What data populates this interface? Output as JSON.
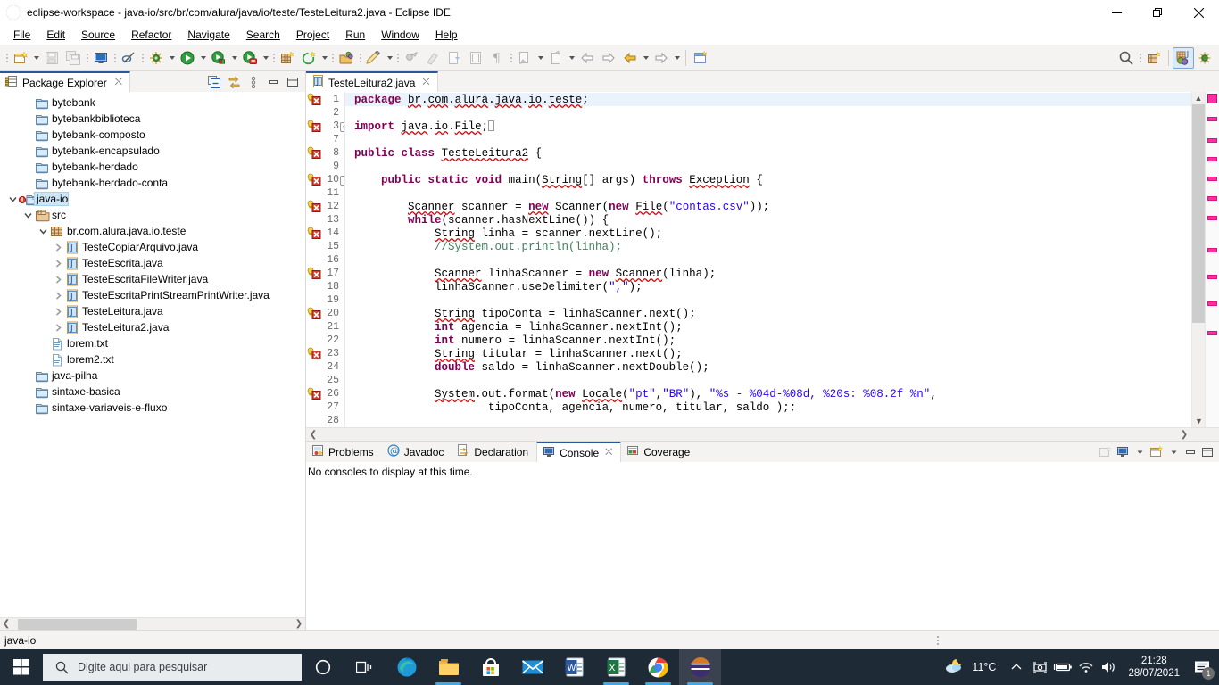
{
  "window": {
    "title": "eclipse-workspace - java-io/src/br/com/alura/java/io/teste/TesteLeitura2.java - Eclipse IDE",
    "minimize": "—",
    "maximize": "❐",
    "close": "✕"
  },
  "menu": [
    {
      "label": "File"
    },
    {
      "label": "Edit"
    },
    {
      "label": "Source"
    },
    {
      "label": "Refactor"
    },
    {
      "label": "Navigate"
    },
    {
      "label": "Search"
    },
    {
      "label": "Project"
    },
    {
      "label": "Run"
    },
    {
      "label": "Window"
    },
    {
      "label": "Help"
    }
  ],
  "toolbar": {
    "items": [
      "new-wizard-icon",
      "save-icon",
      "save-all-icon",
      "print-icon",
      "toggle-mark-occurrences-icon",
      "debug-icon",
      "run-icon",
      "run-external-tools-icon",
      "coverage-icon",
      "new-java-project-icon",
      "open-task-icon",
      "open-type-icon",
      "search-icon",
      "new-window-icon",
      "java-perspective-icon",
      "debug-perspective-icon"
    ]
  },
  "package_explorer": {
    "tab_label": "Package Explorer",
    "tools": [
      "collapse-all-icon",
      "link-with-editor-icon",
      "view-menu-icon",
      "minimize-icon",
      "maximize-icon"
    ],
    "tree": [
      {
        "label": "bytebank",
        "icon": "project-closed-icon",
        "depth": 1,
        "twisty": "",
        "selected": false
      },
      {
        "label": "bytebankbiblioteca",
        "icon": "project-closed-icon",
        "depth": 1,
        "twisty": "",
        "selected": false
      },
      {
        "label": "bytebank-composto",
        "icon": "project-closed-icon",
        "depth": 1,
        "twisty": "",
        "selected": false
      },
      {
        "label": "bytebank-encapsulado",
        "icon": "project-closed-icon",
        "depth": 1,
        "twisty": "",
        "selected": false
      },
      {
        "label": "bytebank-herdado",
        "icon": "project-closed-icon",
        "depth": 1,
        "twisty": "",
        "selected": false
      },
      {
        "label": "bytebank-herdado-conta",
        "icon": "project-closed-icon",
        "depth": 1,
        "twisty": "",
        "selected": false
      },
      {
        "label": "java-io",
        "icon": "java-project-error-icon",
        "depth": 0,
        "twisty": "expanded",
        "selected": true
      },
      {
        "label": "src",
        "icon": "source-folder-icon",
        "depth": 1,
        "twisty": "expanded",
        "selected": false
      },
      {
        "label": "br.com.alura.java.io.teste",
        "icon": "package-icon",
        "depth": 2,
        "twisty": "expanded",
        "selected": false
      },
      {
        "label": "TesteCopiarArquivo.java",
        "icon": "java-file-icon",
        "depth": 3,
        "twisty": "collapsed",
        "selected": false
      },
      {
        "label": "TesteEscrita.java",
        "icon": "java-file-icon",
        "depth": 3,
        "twisty": "collapsed",
        "selected": false
      },
      {
        "label": "TesteEscritaFileWriter.java",
        "icon": "java-file-icon",
        "depth": 3,
        "twisty": "collapsed",
        "selected": false
      },
      {
        "label": "TesteEscritaPrintStreamPrintWriter.java",
        "icon": "java-file-icon",
        "depth": 3,
        "twisty": "collapsed",
        "selected": false
      },
      {
        "label": "TesteLeitura.java",
        "icon": "java-file-icon",
        "depth": 3,
        "twisty": "collapsed",
        "selected": false
      },
      {
        "label": "TesteLeitura2.java",
        "icon": "java-file-icon",
        "depth": 3,
        "twisty": "collapsed",
        "selected": false
      },
      {
        "label": "lorem.txt",
        "icon": "text-file-icon",
        "depth": 2,
        "twisty": "",
        "selected": false
      },
      {
        "label": "lorem2.txt",
        "icon": "text-file-icon",
        "depth": 2,
        "twisty": "",
        "selected": false
      },
      {
        "label": "java-pilha",
        "icon": "project-closed-icon",
        "depth": 1,
        "twisty": "",
        "selected": false
      },
      {
        "label": "sintaxe-basica",
        "icon": "project-closed-icon",
        "depth": 1,
        "twisty": "",
        "selected": false
      },
      {
        "label": "sintaxe-variaveis-e-fluxo",
        "icon": "project-closed-icon",
        "depth": 1,
        "twisty": "",
        "selected": false
      }
    ]
  },
  "editor": {
    "tab_label": "TesteLeitura2.java",
    "tab_icon": "java-file-icon",
    "lines": [
      {
        "num": "1",
        "marker": true,
        "fold": "",
        "current": true
      },
      {
        "num": "2",
        "marker": false,
        "fold": ""
      },
      {
        "num": "3",
        "marker": true,
        "fold": "+"
      },
      {
        "num": "7",
        "marker": false,
        "fold": ""
      },
      {
        "num": "8",
        "marker": true,
        "fold": ""
      },
      {
        "num": "9",
        "marker": false,
        "fold": ""
      },
      {
        "num": "10",
        "marker": true,
        "fold": "-"
      },
      {
        "num": "11",
        "marker": false,
        "fold": ""
      },
      {
        "num": "12",
        "marker": true,
        "fold": ""
      },
      {
        "num": "13",
        "marker": false,
        "fold": ""
      },
      {
        "num": "14",
        "marker": true,
        "fold": ""
      },
      {
        "num": "15",
        "marker": false,
        "fold": ""
      },
      {
        "num": "16",
        "marker": false,
        "fold": ""
      },
      {
        "num": "17",
        "marker": true,
        "fold": ""
      },
      {
        "num": "18",
        "marker": false,
        "fold": ""
      },
      {
        "num": "19",
        "marker": false,
        "fold": ""
      },
      {
        "num": "20",
        "marker": true,
        "fold": ""
      },
      {
        "num": "21",
        "marker": false,
        "fold": ""
      },
      {
        "num": "22",
        "marker": false,
        "fold": ""
      },
      {
        "num": "23",
        "marker": true,
        "fold": ""
      },
      {
        "num": "24",
        "marker": false,
        "fold": ""
      },
      {
        "num": "25",
        "marker": false,
        "fold": ""
      },
      {
        "num": "26",
        "marker": true,
        "fold": ""
      },
      {
        "num": "27",
        "marker": false,
        "fold": ""
      },
      {
        "num": "28",
        "marker": false,
        "fold": ""
      }
    ],
    "code_plain": [
      "package br.com.alura.java.io.teste;",
      "",
      "import java.io.File;",
      "",
      "public class TesteLeitura2 {",
      "",
      "    public static void main(String[] args) throws Exception {",
      "",
      "        Scanner scanner = new Scanner(new File(\"contas.csv\"));",
      "        while(scanner.hasNextLine()) {",
      "            String linha = scanner.nextLine();",
      "            //System.out.println(linha);",
      "",
      "            Scanner linhaScanner = new Scanner(linha);",
      "            linhaScanner.useDelimiter(\",\");",
      "",
      "            String tipoConta = linhaScanner.next();",
      "            int agencia = linhaScanner.nextInt();",
      "            int numero = linhaScanner.nextInt();",
      "            String titular = linhaScanner.next();",
      "            double saldo = linhaScanner.nextDouble();",
      "",
      "            System.out.format(new Locale(\"pt\",\"BR\"), \"%s - %04d-%08d, %20s: %08.2f %n\",",
      "                    tipoConta, agencia, numero, titular, saldo );;",
      ""
    ],
    "overview_markers": 11
  },
  "console_panel": {
    "tabs": [
      {
        "label": "Problems",
        "icon": "problems-icon",
        "active": false,
        "closable": false
      },
      {
        "label": "Javadoc",
        "icon": "javadoc-icon",
        "active": false,
        "closable": false
      },
      {
        "label": "Declaration",
        "icon": "declaration-icon",
        "active": false,
        "closable": false
      },
      {
        "label": "Console",
        "icon": "console-icon",
        "active": true,
        "closable": true
      },
      {
        "label": "Coverage",
        "icon": "coverage-icon",
        "active": false,
        "closable": false
      }
    ],
    "tools": [
      "clear-console-icon",
      "display-selected-console-icon",
      "open-console-icon",
      "minimize-icon",
      "maximize-icon"
    ],
    "message": "No consoles to display at this time."
  },
  "status_bar": {
    "text": "java-io"
  },
  "taskbar": {
    "start_icon": "windows-start-icon",
    "search_placeholder": "Digite aqui para pesquisar",
    "icons": [
      {
        "name": "cortana-icon",
        "open": false
      },
      {
        "name": "task-view-icon",
        "open": false
      },
      {
        "name": "microsoft-edge-icon",
        "open": false
      },
      {
        "name": "file-explorer-icon",
        "open": true
      },
      {
        "name": "microsoft-store-icon",
        "open": false
      },
      {
        "name": "mail-icon",
        "open": false
      },
      {
        "name": "word-icon",
        "open": false
      },
      {
        "name": "excel-icon",
        "open": true
      },
      {
        "name": "google-chrome-icon",
        "open": true
      },
      {
        "name": "eclipse-icon",
        "open": true,
        "active": true
      }
    ],
    "weather": {
      "icon": "partly-cloudy-night-icon",
      "temperature": "11°C"
    },
    "tray_icons": [
      "show-hidden-icons-chevron",
      "onedrive-icon",
      "battery-icon",
      "wifi-icon",
      "volume-icon"
    ],
    "clock": {
      "time": "21:28",
      "date": "28/07/2021"
    },
    "notification": {
      "icon": "action-center-icon",
      "count": "1"
    }
  }
}
